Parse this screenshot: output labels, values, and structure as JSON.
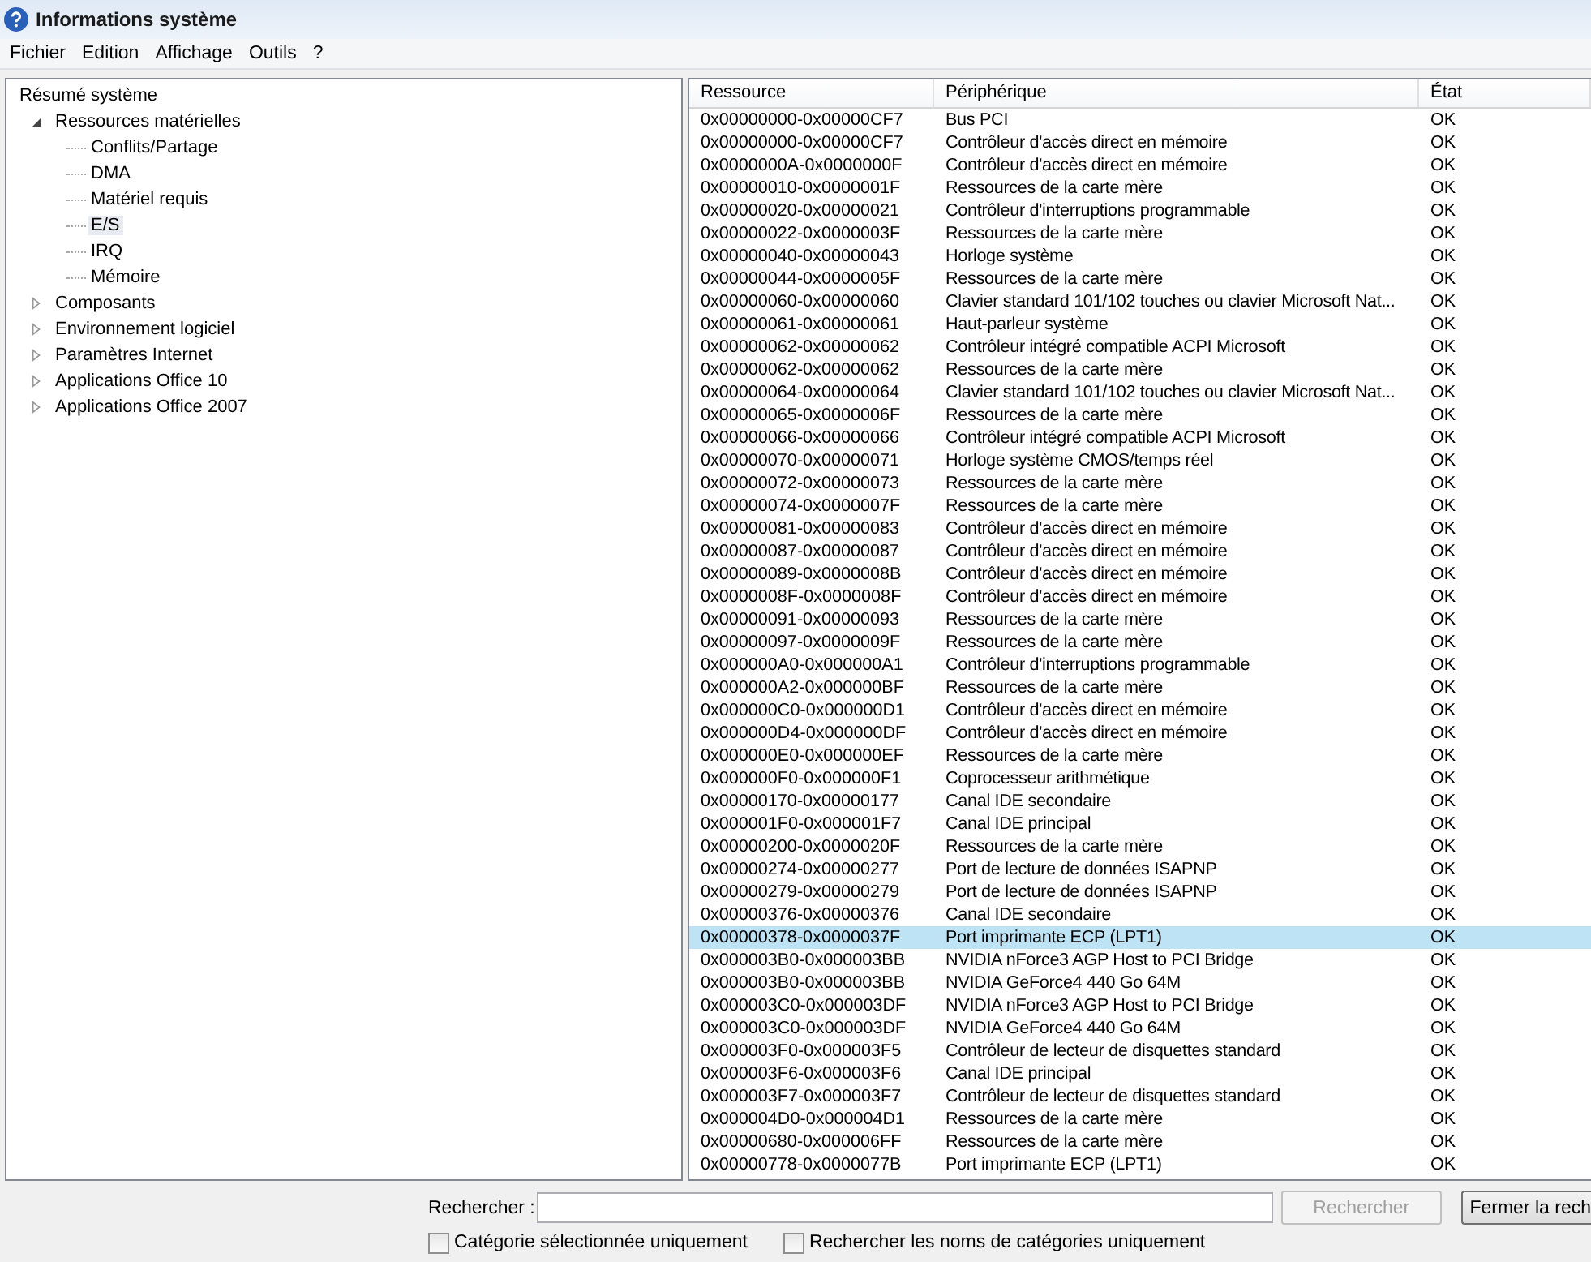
{
  "window": {
    "title": "Informations système"
  },
  "menu": [
    "Fichier",
    "Edition",
    "Affichage",
    "Outils",
    "?"
  ],
  "tree": [
    {
      "label": "Résumé système",
      "selected": false,
      "children": [
        {
          "label": "Ressources matérielles",
          "selected": false,
          "expanded": true,
          "children": [
            {
              "label": "Conflits/Partage",
              "selected": false
            },
            {
              "label": "DMA",
              "selected": false
            },
            {
              "label": "Matériel requis",
              "selected": false
            },
            {
              "label": "E/S",
              "selected": true
            },
            {
              "label": "IRQ",
              "selected": false
            },
            {
              "label": "Mémoire",
              "selected": false
            }
          ]
        },
        {
          "label": "Composants",
          "selected": false,
          "expanded": false
        },
        {
          "label": "Environnement logiciel",
          "selected": false,
          "expanded": false
        },
        {
          "label": "Paramètres Internet",
          "selected": false,
          "expanded": false
        },
        {
          "label": "Applications Office 10",
          "selected": false,
          "expanded": false
        },
        {
          "label": "Applications Office 2007",
          "selected": false,
          "expanded": false
        }
      ]
    }
  ],
  "table": {
    "columns": [
      "Ressource",
      "Périphérique",
      "État"
    ],
    "rows": [
      {
        "cells": [
          "0x00000000-0x00000CF7",
          "Bus PCI",
          "OK"
        ],
        "selected": false
      },
      {
        "cells": [
          "0x00000000-0x00000CF7",
          "Contrôleur d'accès direct en mémoire",
          "OK"
        ],
        "selected": false
      },
      {
        "cells": [
          "0x0000000A-0x0000000F",
          "Contrôleur d'accès direct en mémoire",
          "OK"
        ],
        "selected": false
      },
      {
        "cells": [
          "0x00000010-0x0000001F",
          "Ressources de la carte mère",
          "OK"
        ],
        "selected": false
      },
      {
        "cells": [
          "0x00000020-0x00000021",
          "Contrôleur d'interruptions programmable",
          "OK"
        ],
        "selected": false
      },
      {
        "cells": [
          "0x00000022-0x0000003F",
          "Ressources de la carte mère",
          "OK"
        ],
        "selected": false
      },
      {
        "cells": [
          "0x00000040-0x00000043",
          "Horloge système",
          "OK"
        ],
        "selected": false
      },
      {
        "cells": [
          "0x00000044-0x0000005F",
          "Ressources de la carte mère",
          "OK"
        ],
        "selected": false
      },
      {
        "cells": [
          "0x00000060-0x00000060",
          "Clavier standard 101/102 touches ou clavier Microsoft Nat...",
          "OK"
        ],
        "selected": false
      },
      {
        "cells": [
          "0x00000061-0x00000061",
          "Haut-parleur système",
          "OK"
        ],
        "selected": false
      },
      {
        "cells": [
          "0x00000062-0x00000062",
          "Contrôleur intégré compatible ACPI Microsoft",
          "OK"
        ],
        "selected": false
      },
      {
        "cells": [
          "0x00000062-0x00000062",
          "Ressources de la carte mère",
          "OK"
        ],
        "selected": false
      },
      {
        "cells": [
          "0x00000064-0x00000064",
          "Clavier standard 101/102 touches ou clavier Microsoft Nat...",
          "OK"
        ],
        "selected": false
      },
      {
        "cells": [
          "0x00000065-0x0000006F",
          "Ressources de la carte mère",
          "OK"
        ],
        "selected": false
      },
      {
        "cells": [
          "0x00000066-0x00000066",
          "Contrôleur intégré compatible ACPI Microsoft",
          "OK"
        ],
        "selected": false
      },
      {
        "cells": [
          "0x00000070-0x00000071",
          "Horloge système CMOS/temps réel",
          "OK"
        ],
        "selected": false
      },
      {
        "cells": [
          "0x00000072-0x00000073",
          "Ressources de la carte mère",
          "OK"
        ],
        "selected": false
      },
      {
        "cells": [
          "0x00000074-0x0000007F",
          "Ressources de la carte mère",
          "OK"
        ],
        "selected": false
      },
      {
        "cells": [
          "0x00000081-0x00000083",
          "Contrôleur d'accès direct en mémoire",
          "OK"
        ],
        "selected": false
      },
      {
        "cells": [
          "0x00000087-0x00000087",
          "Contrôleur d'accès direct en mémoire",
          "OK"
        ],
        "selected": false
      },
      {
        "cells": [
          "0x00000089-0x0000008B",
          "Contrôleur d'accès direct en mémoire",
          "OK"
        ],
        "selected": false
      },
      {
        "cells": [
          "0x0000008F-0x0000008F",
          "Contrôleur d'accès direct en mémoire",
          "OK"
        ],
        "selected": false
      },
      {
        "cells": [
          "0x00000091-0x00000093",
          "Ressources de la carte mère",
          "OK"
        ],
        "selected": false
      },
      {
        "cells": [
          "0x00000097-0x0000009F",
          "Ressources de la carte mère",
          "OK"
        ],
        "selected": false
      },
      {
        "cells": [
          "0x000000A0-0x000000A1",
          "Contrôleur d'interruptions programmable",
          "OK"
        ],
        "selected": false
      },
      {
        "cells": [
          "0x000000A2-0x000000BF",
          "Ressources de la carte mère",
          "OK"
        ],
        "selected": false
      },
      {
        "cells": [
          "0x000000C0-0x000000D1",
          "Contrôleur d'accès direct en mémoire",
          "OK"
        ],
        "selected": false
      },
      {
        "cells": [
          "0x000000D4-0x000000DF",
          "Contrôleur d'accès direct en mémoire",
          "OK"
        ],
        "selected": false
      },
      {
        "cells": [
          "0x000000E0-0x000000EF",
          "Ressources de la carte mère",
          "OK"
        ],
        "selected": false
      },
      {
        "cells": [
          "0x000000F0-0x000000F1",
          "Coprocesseur arithmétique",
          "OK"
        ],
        "selected": false
      },
      {
        "cells": [
          "0x00000170-0x00000177",
          "Canal IDE secondaire",
          "OK"
        ],
        "selected": false
      },
      {
        "cells": [
          "0x000001F0-0x000001F7",
          "Canal IDE principal",
          "OK"
        ],
        "selected": false
      },
      {
        "cells": [
          "0x00000200-0x0000020F",
          "Ressources de la carte mère",
          "OK"
        ],
        "selected": false
      },
      {
        "cells": [
          "0x00000274-0x00000277",
          "Port de lecture de données ISAPNP",
          "OK"
        ],
        "selected": false
      },
      {
        "cells": [
          "0x00000279-0x00000279",
          "Port de lecture de données ISAPNP",
          "OK"
        ],
        "selected": false
      },
      {
        "cells": [
          "0x00000376-0x00000376",
          "Canal IDE secondaire",
          "OK"
        ],
        "selected": false
      },
      {
        "cells": [
          "0x00000378-0x0000037F",
          "Port imprimante ECP (LPT1)",
          "OK"
        ],
        "selected": true
      },
      {
        "cells": [
          "0x000003B0-0x000003BB",
          "NVIDIA nForce3 AGP Host to PCI Bridge",
          "OK"
        ],
        "selected": false
      },
      {
        "cells": [
          "0x000003B0-0x000003BB",
          "NVIDIA GeForce4 440 Go 64M",
          "OK"
        ],
        "selected": false
      },
      {
        "cells": [
          "0x000003C0-0x000003DF",
          "NVIDIA nForce3 AGP Host to PCI Bridge",
          "OK"
        ],
        "selected": false
      },
      {
        "cells": [
          "0x000003C0-0x000003DF",
          "NVIDIA GeForce4 440 Go 64M",
          "OK"
        ],
        "selected": false
      },
      {
        "cells": [
          "0x000003F0-0x000003F5",
          "Contrôleur de lecteur de disquettes standard",
          "OK"
        ],
        "selected": false
      },
      {
        "cells": [
          "0x000003F6-0x000003F6",
          "Canal IDE principal",
          "OK"
        ],
        "selected": false
      },
      {
        "cells": [
          "0x000003F7-0x000003F7",
          "Contrôleur de lecteur de disquettes standard",
          "OK"
        ],
        "selected": false
      },
      {
        "cells": [
          "0x000004D0-0x000004D1",
          "Ressources de la carte mère",
          "OK"
        ],
        "selected": false
      },
      {
        "cells": [
          "0x00000680-0x000006FF",
          "Ressources de la carte mère",
          "OK"
        ],
        "selected": false
      },
      {
        "cells": [
          "0x00000778-0x0000077B",
          "Port imprimante ECP (LPT1)",
          "OK"
        ],
        "selected": false
      }
    ]
  },
  "search": {
    "label": "Rechercher :",
    "search_button": {
      "label": "Rechercher",
      "disabled": true
    },
    "close_button": "Fermer la rech"
  },
  "options": [
    {
      "label": "Catégorie sélectionnée uniquement",
      "checked": false
    },
    {
      "label": "Rechercher les noms de catégories uniquement",
      "checked": false
    }
  ]
}
